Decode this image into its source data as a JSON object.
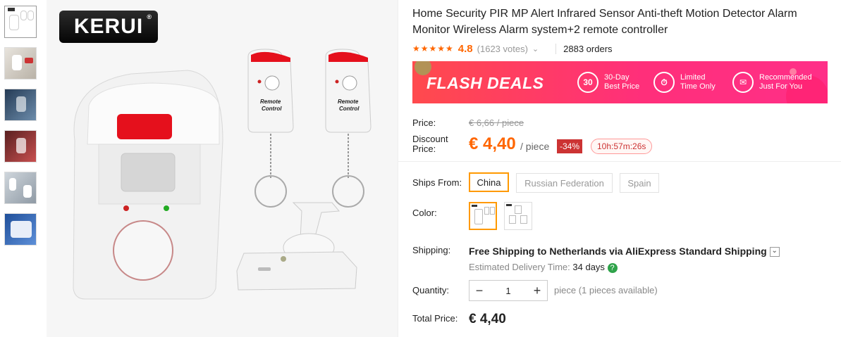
{
  "thumbnails": [
    {
      "name": "thumb-1"
    },
    {
      "name": "thumb-2"
    },
    {
      "name": "thumb-3"
    },
    {
      "name": "thumb-4"
    },
    {
      "name": "thumb-5"
    },
    {
      "name": "thumb-6"
    }
  ],
  "brand": {
    "logo_text": "KERUI",
    "reg": "®"
  },
  "product": {
    "title": "Home Security PIR MP Alert Infrared Sensor Anti-theft Motion Detector Alarm Monitor Wireless Alarm system+2 remote controller",
    "rating_stars": "★★★★★",
    "rating": "4.8",
    "votes": "(1623 votes)",
    "orders": "2883 orders"
  },
  "flash": {
    "title": "FLASH DEALS",
    "features": [
      {
        "icon": "30",
        "line1": "30-Day",
        "line2": "Best Price"
      },
      {
        "icon": "⏱",
        "line1": "Limited",
        "line2": "Time Only"
      },
      {
        "icon": "✉",
        "line1": "Recommended",
        "line2": "Just For You"
      }
    ]
  },
  "price": {
    "label": "Price:",
    "old": "€ 6,66 / piece",
    "discount_label_1": "Discount",
    "discount_label_2": "Price:",
    "current": "€ 4,40",
    "unit": "/ piece",
    "discount": "-34%",
    "timer": "10h:57m:26s"
  },
  "ships_from": {
    "label": "Ships From:",
    "options": [
      "China",
      "Russian Federation",
      "Spain"
    ],
    "selected": "China"
  },
  "color": {
    "label": "Color:"
  },
  "shipping": {
    "label": "Shipping:",
    "line": "Free Shipping to Netherlands via AliExpress Standard Shipping",
    "chevron": "⌄",
    "delivery_label": "Estimated Delivery Time:",
    "delivery_days": "34  days",
    "help": "?"
  },
  "quantity": {
    "label": "Quantity:",
    "minus": "−",
    "value": "1",
    "plus": "+",
    "note": "piece (1 pieces available)"
  },
  "total": {
    "label": "Total Price:",
    "value": "€ 4,40"
  },
  "colors": {
    "accent": "#ff6600",
    "flash_start": "#ff4a4d",
    "flash_end": "#ff2f88",
    "selected_border": "#ff9900"
  }
}
